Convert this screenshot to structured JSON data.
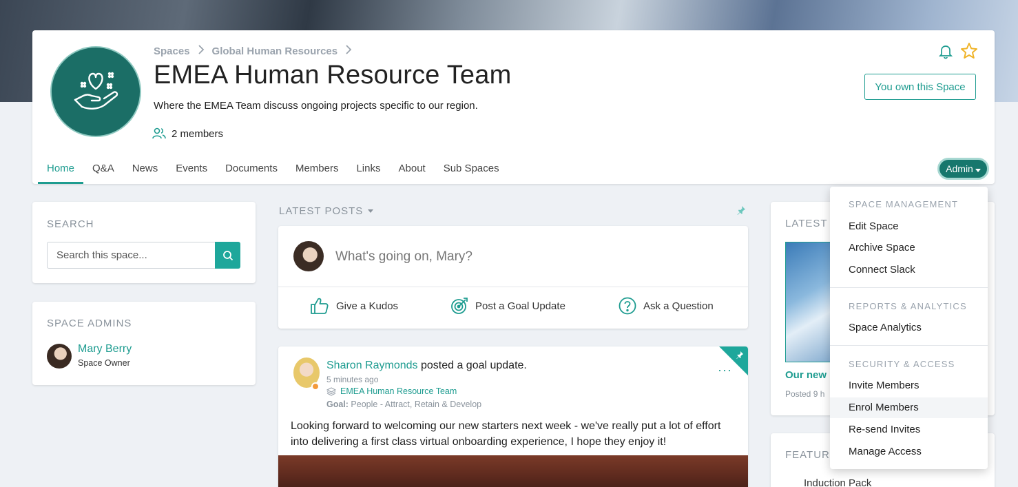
{
  "breadcrumb": {
    "item1": "Spaces",
    "item2": "Global Human Resources"
  },
  "space": {
    "title": "EMEA Human Resource Team",
    "description": "Where the EMEA Team discuss ongoing projects specific to our region.",
    "members": "2 members",
    "own_label": "You own this Space"
  },
  "tabs": [
    "Home",
    "Q&A",
    "News",
    "Events",
    "Documents",
    "Members",
    "Links",
    "About",
    "Sub Spaces"
  ],
  "admin_button": "Admin",
  "search": {
    "title": "SEARCH",
    "placeholder": "Search this space..."
  },
  "space_admins": {
    "title": "SPACE ADMINS",
    "name": "Mary Berry",
    "role": "Space Owner"
  },
  "feed": {
    "header": "LATEST POSTS",
    "composer_prompt": "What's going on, Mary?",
    "actions": {
      "kudos": "Give a Kudos",
      "goal": "Post a Goal Update",
      "question": "Ask a Question"
    }
  },
  "post": {
    "author": "Sharon Raymonds",
    "action": " posted a goal update.",
    "time": "5 minutes ago",
    "space": "EMEA Human Resource Team",
    "goal_label": "Goal:",
    "goal_value": " People - Attract, Retain & Develop",
    "body": "Looking forward to welcoming our new starters next week - we've really put a lot of effort into delivering a first class virtual onboarding experience, I hope they enjoy it!",
    "menu": "···"
  },
  "right": {
    "latest_title": "LATEST",
    "news_title": "Our new",
    "news_meta": "Posted 9 h",
    "featured_title": "FEATUR",
    "featured_item": "Induction Pack"
  },
  "dropdown": {
    "section1": "SPACE MANAGEMENT",
    "edit": "Edit Space",
    "archive": "Archive Space",
    "slack": "Connect Slack",
    "section2": "REPORTS & ANALYTICS",
    "analytics": "Space Analytics",
    "section3": "SECURITY & ACCESS",
    "invite": "Invite Members",
    "enrol": "Enrol Members",
    "resend": "Re-send Invites",
    "manage": "Manage Access"
  },
  "colors": {
    "accent": "#1e9c90",
    "logo": "#1b6e66",
    "admin_button": "#17776d",
    "star": "#f0b429"
  },
  "icons": [
    "heart-hand-logo",
    "bell-icon",
    "star-icon",
    "members-icon",
    "search-icon",
    "pin-icon",
    "thumbs-up-icon",
    "target-icon",
    "question-icon",
    "layers-icon"
  ]
}
